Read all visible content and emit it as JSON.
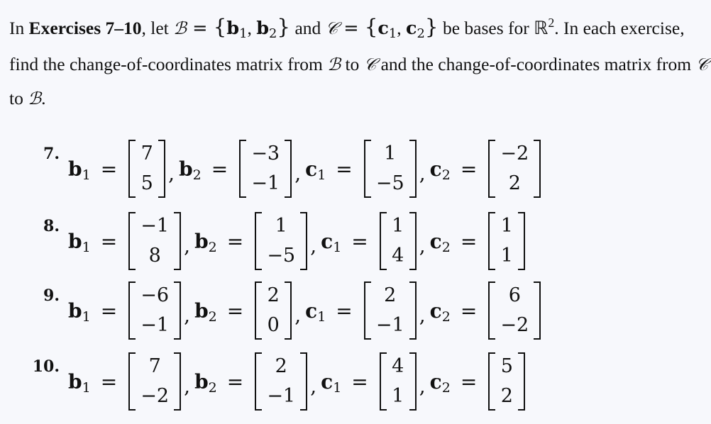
{
  "intro": {
    "lead": "In ",
    "exercises_range": "Exercises 7–10",
    "let_text": ", let ",
    "basis_B_symbol": "ℬ",
    "equals": " = ",
    "open_brace": "{",
    "close_brace": "}",
    "b_name": "b",
    "sub1": "1",
    "sub2": "2",
    "comma": ", ",
    "and_text": " and ",
    "basis_C_symbol": "𝒞",
    "c_name": "c",
    "be_bases_text": " be bases for ",
    "real_symbol": "ℝ",
    "dim": "2",
    "line_end": ". In each exercise, find the change-of-coordinates matrix from ",
    "to_text": " to ",
    "and_the_text": " and the change-of-coordinates matrix from ",
    "period": "."
  },
  "exercises": [
    {
      "number": "7.",
      "b1": [
        "7",
        "5"
      ],
      "b2": [
        "−3",
        "−1"
      ],
      "c1": [
        "1",
        "−5"
      ],
      "c2": [
        "−2",
        "2"
      ]
    },
    {
      "number": "8.",
      "b1": [
        "−1",
        "8"
      ],
      "b2": [
        "1",
        "−5"
      ],
      "c1": [
        "1",
        "4"
      ],
      "c2": [
        "1",
        "1"
      ]
    },
    {
      "number": "9.",
      "b1": [
        "−6",
        "−1"
      ],
      "b2": [
        "2",
        "0"
      ],
      "c1": [
        "2",
        "−1"
      ],
      "c2": [
        "6",
        "−2"
      ]
    },
    {
      "number": "10.",
      "b1": [
        "7",
        "−2"
      ],
      "b2": [
        "2",
        "−1"
      ],
      "c1": [
        "4",
        "1"
      ],
      "c2": [
        "5",
        "2"
      ]
    }
  ],
  "labels": {
    "b": "b",
    "c": "c",
    "one": "1",
    "two": "2",
    "eq": "=",
    "comma": ","
  }
}
